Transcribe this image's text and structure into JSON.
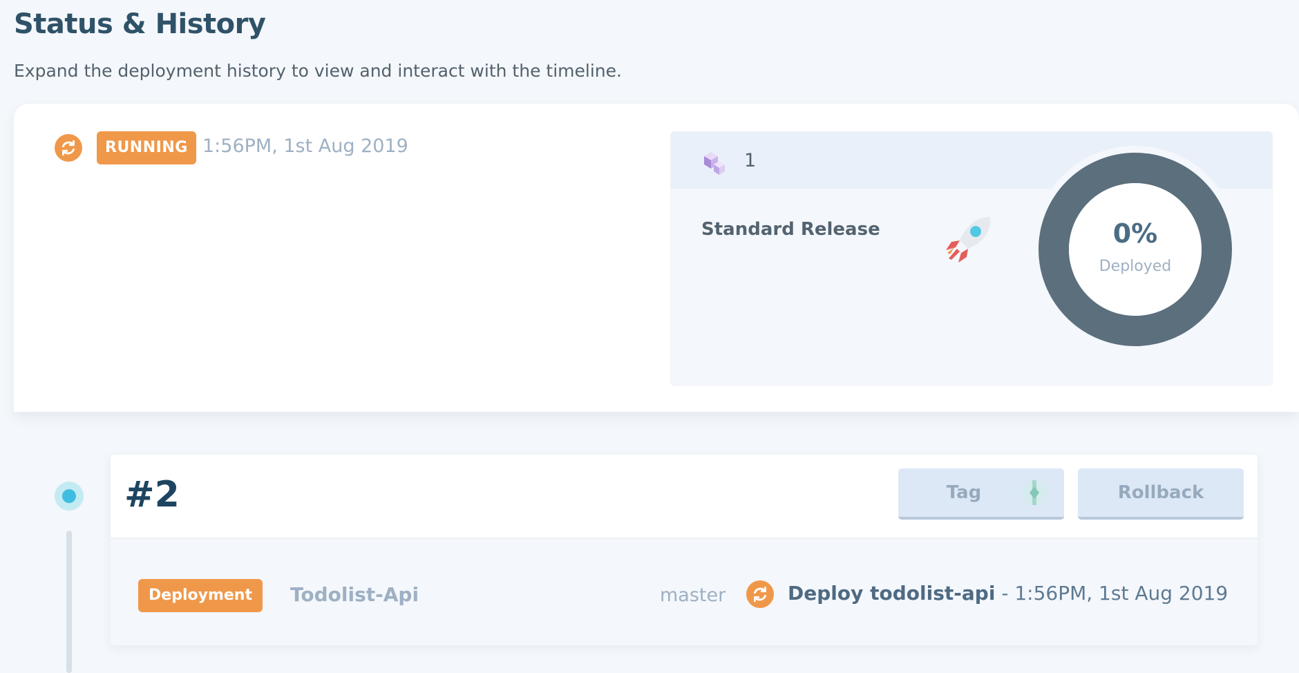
{
  "header": {
    "title": "Status & History",
    "subtitle": "Expand the deployment history to view and interact with the timeline."
  },
  "status": {
    "icon": "sync-icon",
    "badge": "RUNNING",
    "timestamp": "1:56PM, 1st Aug 2019",
    "release": {
      "count": "1",
      "count_icon": "cube-icon",
      "name": "Standard Release",
      "name_icon": "rocket-icon",
      "progress_percent": 0,
      "progress_label": "0%",
      "progress_caption": "Deployed"
    }
  },
  "history": {
    "deployments": [
      {
        "number": "#2",
        "tag_label": "Tag",
        "rollback_label": "Rollback",
        "type_badge": "Deployment",
        "app": "Todolist-Api",
        "branch": "master",
        "action": "Deploy todolist-api",
        "separator": " - ",
        "time": "1:56PM, 1st Aug 2019"
      }
    ]
  },
  "colors": {
    "accent_orange": "#f0984a",
    "title": "#2f5268",
    "gauge_ring": "#5b6f7d",
    "timeline_dot": "#3ebde0",
    "button_bg": "#dde8f7"
  }
}
